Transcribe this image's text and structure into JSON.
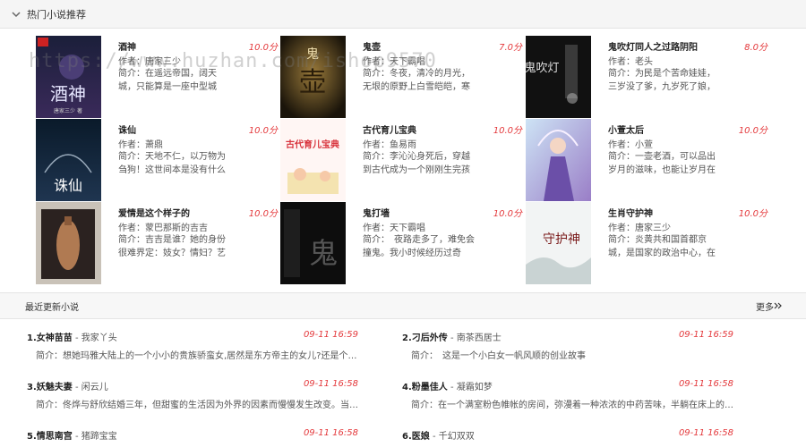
{
  "hot": {
    "title": "热门小说推荐",
    "books": [
      {
        "title": "酒神",
        "score": "10.0分",
        "author": "作者：唐家三少",
        "intro": "简介：在遥远帝国，阔天城，只能算是一座中型城市，但",
        "cover_text": "酒神",
        "cover_sub": "唐家三少 著"
      },
      {
        "title": "鬼壶",
        "score": "7.0分",
        "author": "作者：天下霸唱",
        "intro": "简介：冬夜，清冷的月光，无垠的原野上白雪皑皑，寒",
        "cover_text": "壶",
        "cover_sub": ""
      },
      {
        "title": "鬼吹灯同人之过路阴阳",
        "score": "8.0分",
        "author": "作者：老头",
        "intro": "简介：为民是个苦命娃娃，三岁没了爹，九岁死了娘，",
        "cover_text": "鬼吹灯",
        "cover_sub": ""
      },
      {
        "title": "诛仙",
        "score": "10.0分",
        "author": "作者：萧鼎",
        "intro": "简介：天地不仁，以万物为刍狗！这世间本是没有什么",
        "cover_text": "诛仙",
        "cover_sub": ""
      },
      {
        "title": "古代育儿宝典",
        "score": "10.0分",
        "author": "作者：鱼易雨",
        "intro": "简介：李沁沁身死后，穿越到古代成为一个刚刚生完孩",
        "cover_text": "古代育儿宝典",
        "cover_sub": ""
      },
      {
        "title": "小萱太后",
        "score": "10.0分",
        "author": "作者：小萱",
        "intro": "简介：一壶老酒，可以品出岁月的滋味，也能让岁月在",
        "cover_text": "",
        "cover_sub": ""
      },
      {
        "title": "爱情是这个样子的",
        "score": "10.0分",
        "author": "作者：蒙巴那斯的吉吉",
        "intro": "简介：吉吉是谁？她的身份很难界定：妓女？情妇？艺",
        "cover_text": "",
        "cover_sub": ""
      },
      {
        "title": "鬼打墙",
        "score": "10.0分",
        "author": "作者：天下霸唱",
        "intro": "简介：　夜路走多了，难免会撞鬼。我小时候经历过奇",
        "cover_text": "鬼",
        "cover_sub": ""
      },
      {
        "title": "生肖守护神",
        "score": "10.0分",
        "author": "作者：唐家三少",
        "intro": "简介：炎黄共和国首都京城，是国家的政治中心，在",
        "cover_text": "守护神",
        "cover_sub": ""
      }
    ]
  },
  "recent": {
    "title": "最近更新小说",
    "more": "更多",
    "items": [
      {
        "index": "1.",
        "title": "女神苗苗",
        "author": "我家丫头",
        "time": "09-11 16:59",
        "intro": "简介：想她玛雅大陆上的一个小小的贵族骄蛮女,居然是东方帝主的女儿?还是个被..."
      },
      {
        "index": "2.",
        "title": "刁后外传",
        "author": "南茶西居士",
        "time": "09-11 16:59",
        "intro": "简介：　这是一个小白女一帆风顺的创业故事"
      },
      {
        "index": "3.",
        "title": "妖魅夫妻",
        "author": "闲云儿",
        "time": "09-11 16:58",
        "intro": "简介：佟烨与舒欣结婚三年，但甜蜜的生活因为外界的因素而慢慢发生改变。当佟..."
      },
      {
        "index": "4.",
        "title": "粉墨佳人",
        "author": "凝霜如梦",
        "time": "09-11 16:58",
        "intro": "简介：在一个满室粉色帷帐的房间，弥漫着一种浓浓的中药苦味，半躺在床上的富..."
      },
      {
        "index": "5.",
        "title": "情思南宫",
        "author": "猪蹄宝宝",
        "time": "09-11 16:58",
        "intro": ""
      },
      {
        "index": "6.",
        "title": "医娘",
        "author": "千幻双双",
        "time": "09-11 16:58",
        "intro": ""
      }
    ]
  },
  "watermark": "https://www.huzhan.com/ishop9570",
  "colors": {
    "accent": "#e4393c",
    "header_bg": "#f5f5f5"
  },
  "icons": {
    "header": "chevron-down-icon",
    "more": "double-chevron-right-icon"
  }
}
